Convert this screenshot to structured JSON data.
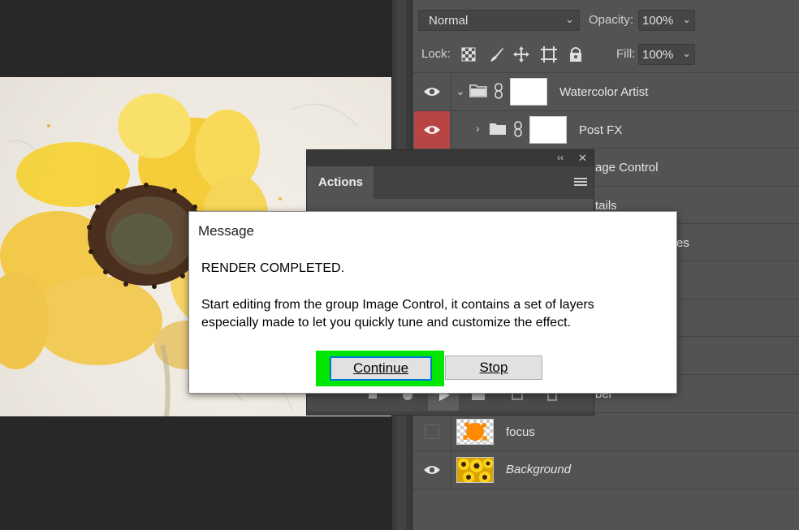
{
  "layers_panel": {
    "blend_mode": "Normal",
    "opacity_label": "Opacity:",
    "opacity_value": "100%",
    "lock_label": "Lock:",
    "fill_label": "Fill:",
    "fill_value": "100%",
    "layers": [
      {
        "name": "Watercolor Artist",
        "type": "group",
        "expanded": true,
        "visible": true
      },
      {
        "name": "Post FX",
        "type": "group",
        "expanded": false,
        "visible": true,
        "highlighted_eye": true
      },
      {
        "name_partial": "age Control"
      },
      {
        "name_partial": "tails"
      },
      {
        "name_partial": "es"
      },
      {
        "name_partial": "bel"
      },
      {
        "name": "focus",
        "type": "layer",
        "visible": false
      },
      {
        "name": "Background",
        "type": "layer",
        "visible": true,
        "italic": true
      }
    ]
  },
  "actions_panel": {
    "tab_label": "Actions",
    "collapse_label": "‹‹",
    "close_label": "✕"
  },
  "dialog": {
    "title": "Message",
    "heading": "RENDER COMPLETED.",
    "body_line1": "Start editing from the group Image Control, it contains a set of layers",
    "body_line2": "especially made to let you quickly tune and customize the effect.",
    "continue_label": "Continue",
    "stop_label": "Stop"
  },
  "colors": {
    "highlight_box": "#00e600",
    "eye_highlight": "#b84444",
    "panel_bg": "#535353"
  }
}
